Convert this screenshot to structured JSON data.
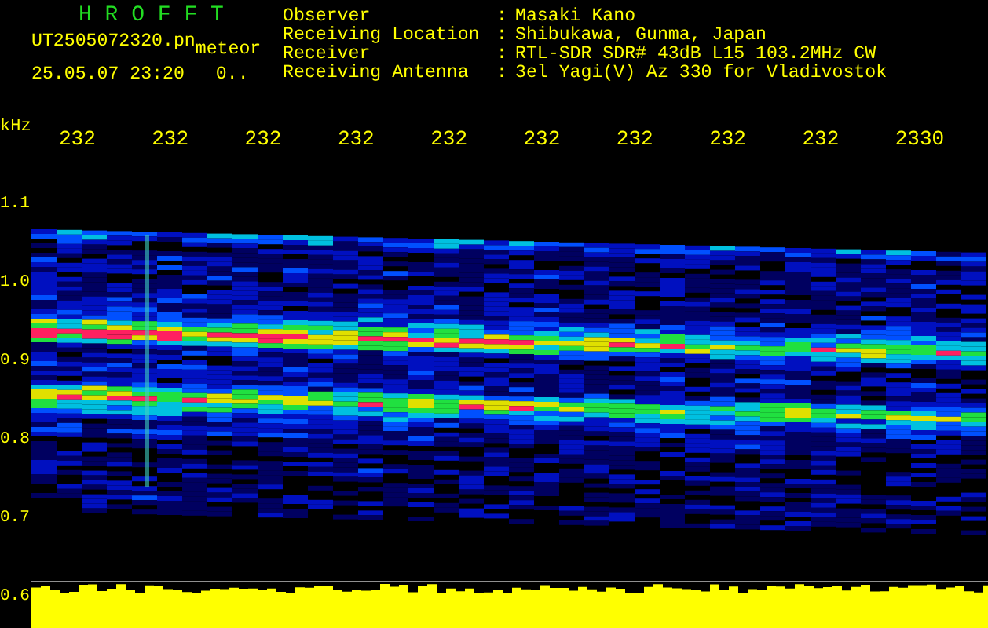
{
  "title": "H R O F F T",
  "file": {
    "name": "UT2505072320.pn",
    "tag": "meteor",
    "datetime": "25.05.07 23:20",
    "counter": "0.."
  },
  "info": [
    {
      "label": "Observer",
      "colon": ":",
      "value": "Masaki Kano"
    },
    {
      "label": "Receiving Location",
      "colon": ":",
      "value": "Shibukawa, Gunma, Japan"
    },
    {
      "label": "Receiver",
      "colon": ":",
      "value": "RTL-SDR SDR# 43dB L15 103.2MHz CW"
    },
    {
      "label": "Receiving Antenna",
      "colon": ":",
      "value": "3el Yagi(V) Az 330 for Vladivostok"
    }
  ],
  "axis": {
    "unit": "kHz",
    "x_ticks": [
      "232",
      "232",
      "232",
      "232",
      "232",
      "232",
      "232",
      "232",
      "232",
      "2330"
    ],
    "y_ticks": [
      "1.1",
      "1.0",
      "0.9",
      "0.8",
      "0.7",
      "0.6"
    ]
  }
}
